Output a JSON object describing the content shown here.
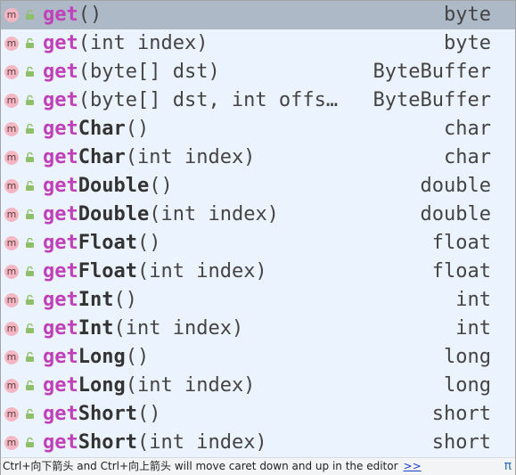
{
  "completion": {
    "items": [
      {
        "match": "get",
        "suffix": "",
        "params": "()",
        "type": "byte",
        "selected": true
      },
      {
        "match": "get",
        "suffix": "",
        "params": "(int index)",
        "type": "byte"
      },
      {
        "match": "get",
        "suffix": "",
        "params": "(byte[] dst)",
        "type": "ByteBuffer"
      },
      {
        "match": "get",
        "suffix": "",
        "params": "(byte[] dst, int offs…",
        "type": "ByteBuffer"
      },
      {
        "match": "get",
        "suffix": "Char",
        "params": "()",
        "type": "char"
      },
      {
        "match": "get",
        "suffix": "Char",
        "params": "(int index)",
        "type": "char"
      },
      {
        "match": "get",
        "suffix": "Double",
        "params": "()",
        "type": "double"
      },
      {
        "match": "get",
        "suffix": "Double",
        "params": "(int index)",
        "type": "double"
      },
      {
        "match": "get",
        "suffix": "Float",
        "params": "()",
        "type": "float"
      },
      {
        "match": "get",
        "suffix": "Float",
        "params": "(int index)",
        "type": "float"
      },
      {
        "match": "get",
        "suffix": "Int",
        "params": "()",
        "type": "int"
      },
      {
        "match": "get",
        "suffix": "Int",
        "params": "(int index)",
        "type": "int"
      },
      {
        "match": "get",
        "suffix": "Long",
        "params": "()",
        "type": "long"
      },
      {
        "match": "get",
        "suffix": "Long",
        "params": "(int index)",
        "type": "long"
      },
      {
        "match": "get",
        "suffix": "Short",
        "params": "()",
        "type": "short"
      },
      {
        "match": "get",
        "suffix": "Short",
        "params": "(int index)",
        "type": "short"
      }
    ],
    "icon_letter": "m"
  },
  "footer": {
    "hint": "Ctrl+向下箭头 and Ctrl+向上箭头 will move caret down and up in the editor",
    "more_link": ">>",
    "pi_symbol": "π"
  },
  "colors": {
    "popup_bg": "#ebf4fe",
    "selected_bg": "#aeb9c8",
    "match_text": "#c040b9",
    "method_icon": "#f4b7c2",
    "lock_icon": "#8fbf6a"
  }
}
